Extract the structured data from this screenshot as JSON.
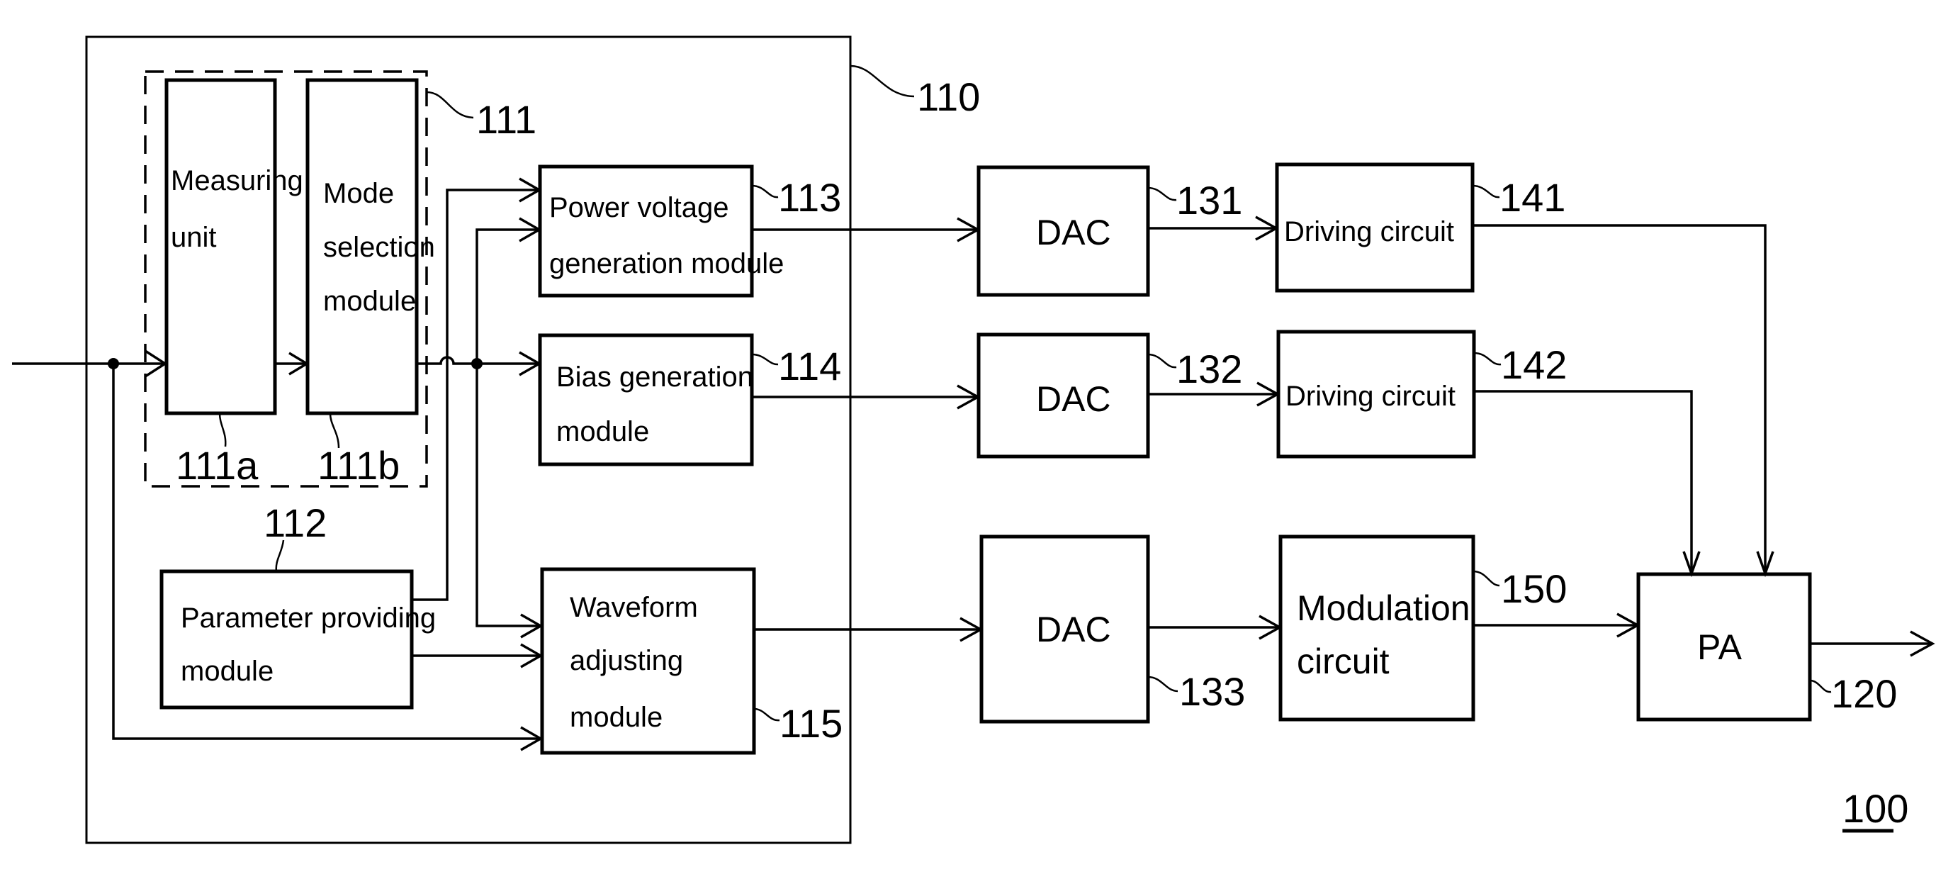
{
  "figure": {
    "title_ref": "100",
    "blocks": {
      "controller": {
        "ref": "110"
      },
      "detection_group": {
        "ref": "111"
      },
      "measuring_unit": {
        "ref": "111a",
        "lines": [
          "Measuring",
          "unit"
        ]
      },
      "mode_selection": {
        "ref": "111b",
        "lines": [
          "Mode",
          "selection",
          "module"
        ]
      },
      "parameter_providing": {
        "ref": "112",
        "lines": [
          "Parameter providing",
          "module"
        ]
      },
      "power_voltage": {
        "ref": "113",
        "lines": [
          "Power voltage",
          "generation module"
        ]
      },
      "bias_generation": {
        "ref": "114",
        "lines": [
          "Bias generation",
          "module"
        ]
      },
      "waveform_adjusting": {
        "ref": "115",
        "lines": [
          "Waveform",
          "adjusting",
          "module"
        ]
      },
      "dac_1": {
        "ref": "131",
        "label": "DAC"
      },
      "dac_2": {
        "ref": "132",
        "label": "DAC"
      },
      "dac_3": {
        "ref": "133",
        "label": "DAC"
      },
      "driving_1": {
        "ref": "141",
        "label": "Driving circuit"
      },
      "driving_2": {
        "ref": "142",
        "label": "Driving circuit"
      },
      "modulation": {
        "ref": "150",
        "lines": [
          "Modulation",
          "circuit"
        ]
      },
      "pa": {
        "ref": "120",
        "label": "PA"
      }
    }
  }
}
